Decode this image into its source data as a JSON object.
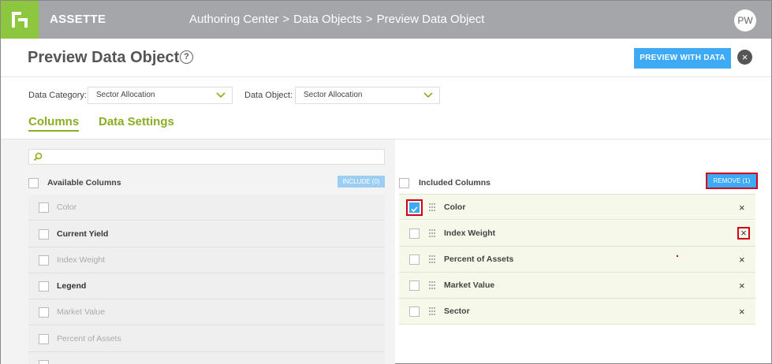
{
  "app": {
    "brand": "ASSETTE",
    "breadcrumb": [
      "Authoring Center",
      "Data Objects",
      "Preview Data Object"
    ],
    "breadcrumb_sep": ">",
    "avatar_initials": "PW"
  },
  "header": {
    "title": "Preview Data Object",
    "help_glyph": "?",
    "preview_button": "PREVIEW WITH DATA",
    "close_glyph": "×"
  },
  "filters": {
    "category_label": "Data Category:",
    "category_value": "Sector Allocation",
    "object_label": "Data Object:",
    "object_value": "Sector Allocation"
  },
  "tabs": [
    {
      "label": "Columns",
      "active": true
    },
    {
      "label": "Data Settings",
      "active": false
    }
  ],
  "available": {
    "header": "Available Columns",
    "include_button": "INCLUDE (0)",
    "rows": [
      {
        "label": "Color",
        "dimmed": true
      },
      {
        "label": "Current Yield",
        "dimmed": false
      },
      {
        "label": "Index Weight",
        "dimmed": true
      },
      {
        "label": "Legend",
        "dimmed": false
      },
      {
        "label": "Market Value",
        "dimmed": true
      },
      {
        "label": "Percent of Assets",
        "dimmed": true
      }
    ]
  },
  "included": {
    "header": "Included Columns",
    "remove_button": "REMOVE (1)",
    "rows": [
      {
        "label": "Color",
        "checked": true
      },
      {
        "label": "Index Weight",
        "checked": false
      },
      {
        "label": "Percent of Assets",
        "checked": false
      },
      {
        "label": "Market Value",
        "checked": false
      },
      {
        "label": "Sector",
        "checked": false
      }
    ],
    "remove_glyph": "×"
  },
  "colors": {
    "brand_green": "#8dc63f",
    "tab_green": "#8aad23",
    "accent_blue": "#3ea9f5",
    "highlight_red": "#d0021b",
    "topbar_gray": "#a4a6a9"
  },
  "icons": {
    "logo": "assette-logo-icon",
    "help": "help-circle-icon",
    "close": "close-circle-icon",
    "chevron": "chevron-down-icon",
    "search": "search-icon",
    "drag": "drag-handle-icon",
    "check": "checkmark-icon"
  }
}
